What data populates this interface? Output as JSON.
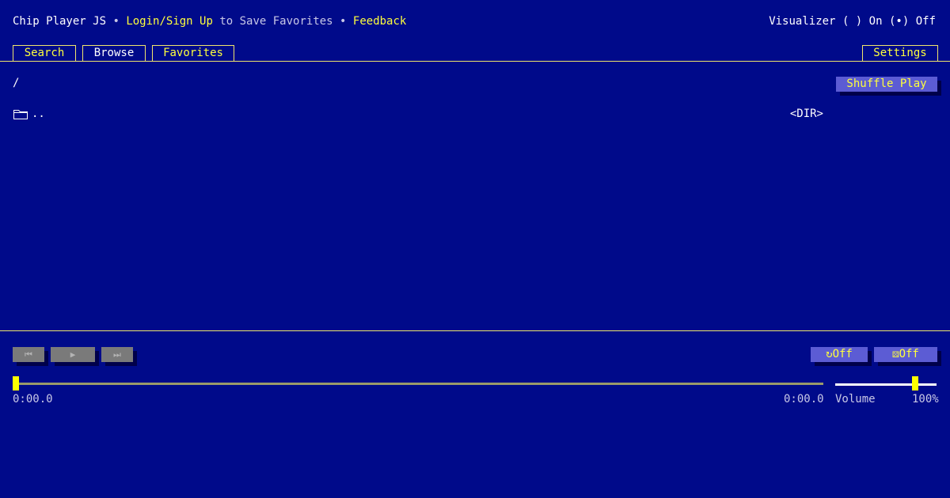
{
  "header": {
    "app_title": "Chip Player JS",
    "bullet1": " • ",
    "login_link": "Login/Sign Up",
    "save_text": " to Save Favorites",
    "bullet2": " • ",
    "feedback_link": "Feedback"
  },
  "visualizer": {
    "label": "Visualizer",
    "on_radio": "( )",
    "on_label": "On",
    "off_radio": "(•)",
    "off_label": "Off",
    "selected": "Off"
  },
  "tabs": {
    "search": "Search",
    "browse": "Browse",
    "favorites": "Favorites",
    "settings": "Settings",
    "active": "Browse"
  },
  "browser": {
    "path": "/",
    "shuffle_label": "Shuffle Play",
    "items": [
      {
        "name": "..",
        "type": "<DIR>",
        "icon": "folder-icon"
      }
    ]
  },
  "player": {
    "prev_icon": "⏮",
    "play_icon": "▶",
    "next_icon": "⏭",
    "repeat_label": "Off",
    "shuffle_label": "Off",
    "elapsed": "0:00.0",
    "duration": "0:00.0",
    "seek_fraction": 0,
    "volume_label": "Volume",
    "volume_value": "100%",
    "volume_fraction": 0.76
  },
  "colors": {
    "background": "#000a8a",
    "accent_yellow": "#ffff3c",
    "button_blue": "#5c5cd4",
    "button_disabled": "#7a7a7a"
  }
}
